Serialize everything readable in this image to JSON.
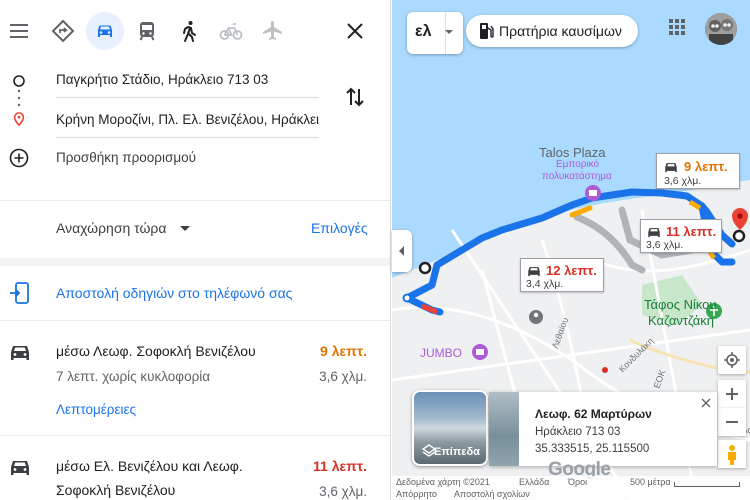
{
  "modes": [
    {
      "icon": "hamburger-menu-icon"
    },
    {
      "icon": "best-route-icon"
    },
    {
      "icon": "car-icon",
      "active": true
    },
    {
      "icon": "transit-icon"
    },
    {
      "icon": "walk-icon"
    },
    {
      "icon": "bicycle-icon"
    },
    {
      "icon": "flight-icon"
    }
  ],
  "origin": "Παγκρήτιο Στάδιο, Ηράκλειο 713 03",
  "destination": "Κρήνη Μοροζίνι, Πλ. Ελ. Βενιζέλου, Ηράκλειο",
  "add_destination": "Προσθήκη προορισμού",
  "depart_label": "Αναχώρηση τώρα",
  "options_label": "Επιλογές",
  "send_to_phone": "Αποστολή οδηγιών στο τηλέφωνό σας",
  "routes": [
    {
      "name": "μέσω Λεωφ. Σοφοκλή Βενιζέλου",
      "time": "9 λεπτ.",
      "time_color": "#e37400",
      "sub": "7 λεπτ. χωρίς κυκλοφορία",
      "distance": "3,6 χλμ.",
      "details": "Λεπτομέρειες"
    },
    {
      "name_line1": "μέσω Ελ. Βενιζέλου και Λεωφ.",
      "name_line2": "Σοφοκλή Βενιζέλου",
      "time": "11 λεπτ.",
      "time_color": "#d93025",
      "distance": "3,6 χλμ."
    }
  ],
  "map": {
    "language": "ελ",
    "chip_label": "Πρατήρια καυσίμων",
    "bubbles": [
      {
        "time": "9 λεπτ.",
        "dist": "3,6 χλμ.",
        "color": "#e37400"
      },
      {
        "time": "11 λεπτ.",
        "dist": "3,6 χλμ.",
        "color": "#d93025"
      },
      {
        "time": "12 λεπτ.",
        "dist": "3,4 χλμ.",
        "color": "#d93025"
      }
    ],
    "labels": {
      "talos_title": "Talos Plaza",
      "talos_sub1": "Εμπορικό",
      "talos_sub2": "πολυκατάστημα",
      "tafos1": "Τάφος Νίκου",
      "tafos2": "Καζαντζάκη",
      "jumbo": "JUMBO",
      "lethaiou": "Λεθαίου",
      "kondylaki": "Κονδυλάκη",
      "eok": "ΕΟΚ",
      "kalo": "Καλο"
    },
    "layer_label": "Επίπεδα",
    "place": {
      "title": "Λεωφ. 62 Μαρτύρων",
      "address": "Ηράκλειο 713 03",
      "coords": "35.333515, 25.115500"
    },
    "footer": {
      "data": "Δεδομένα χάρτη ©2021",
      "greece": "Ελλάδα",
      "terms": "Όροι",
      "feedback": "Αποστολή σχολίων",
      "privacy": "Απόρρητο",
      "scale": "500 μέτρα"
    },
    "google": "Google"
  }
}
